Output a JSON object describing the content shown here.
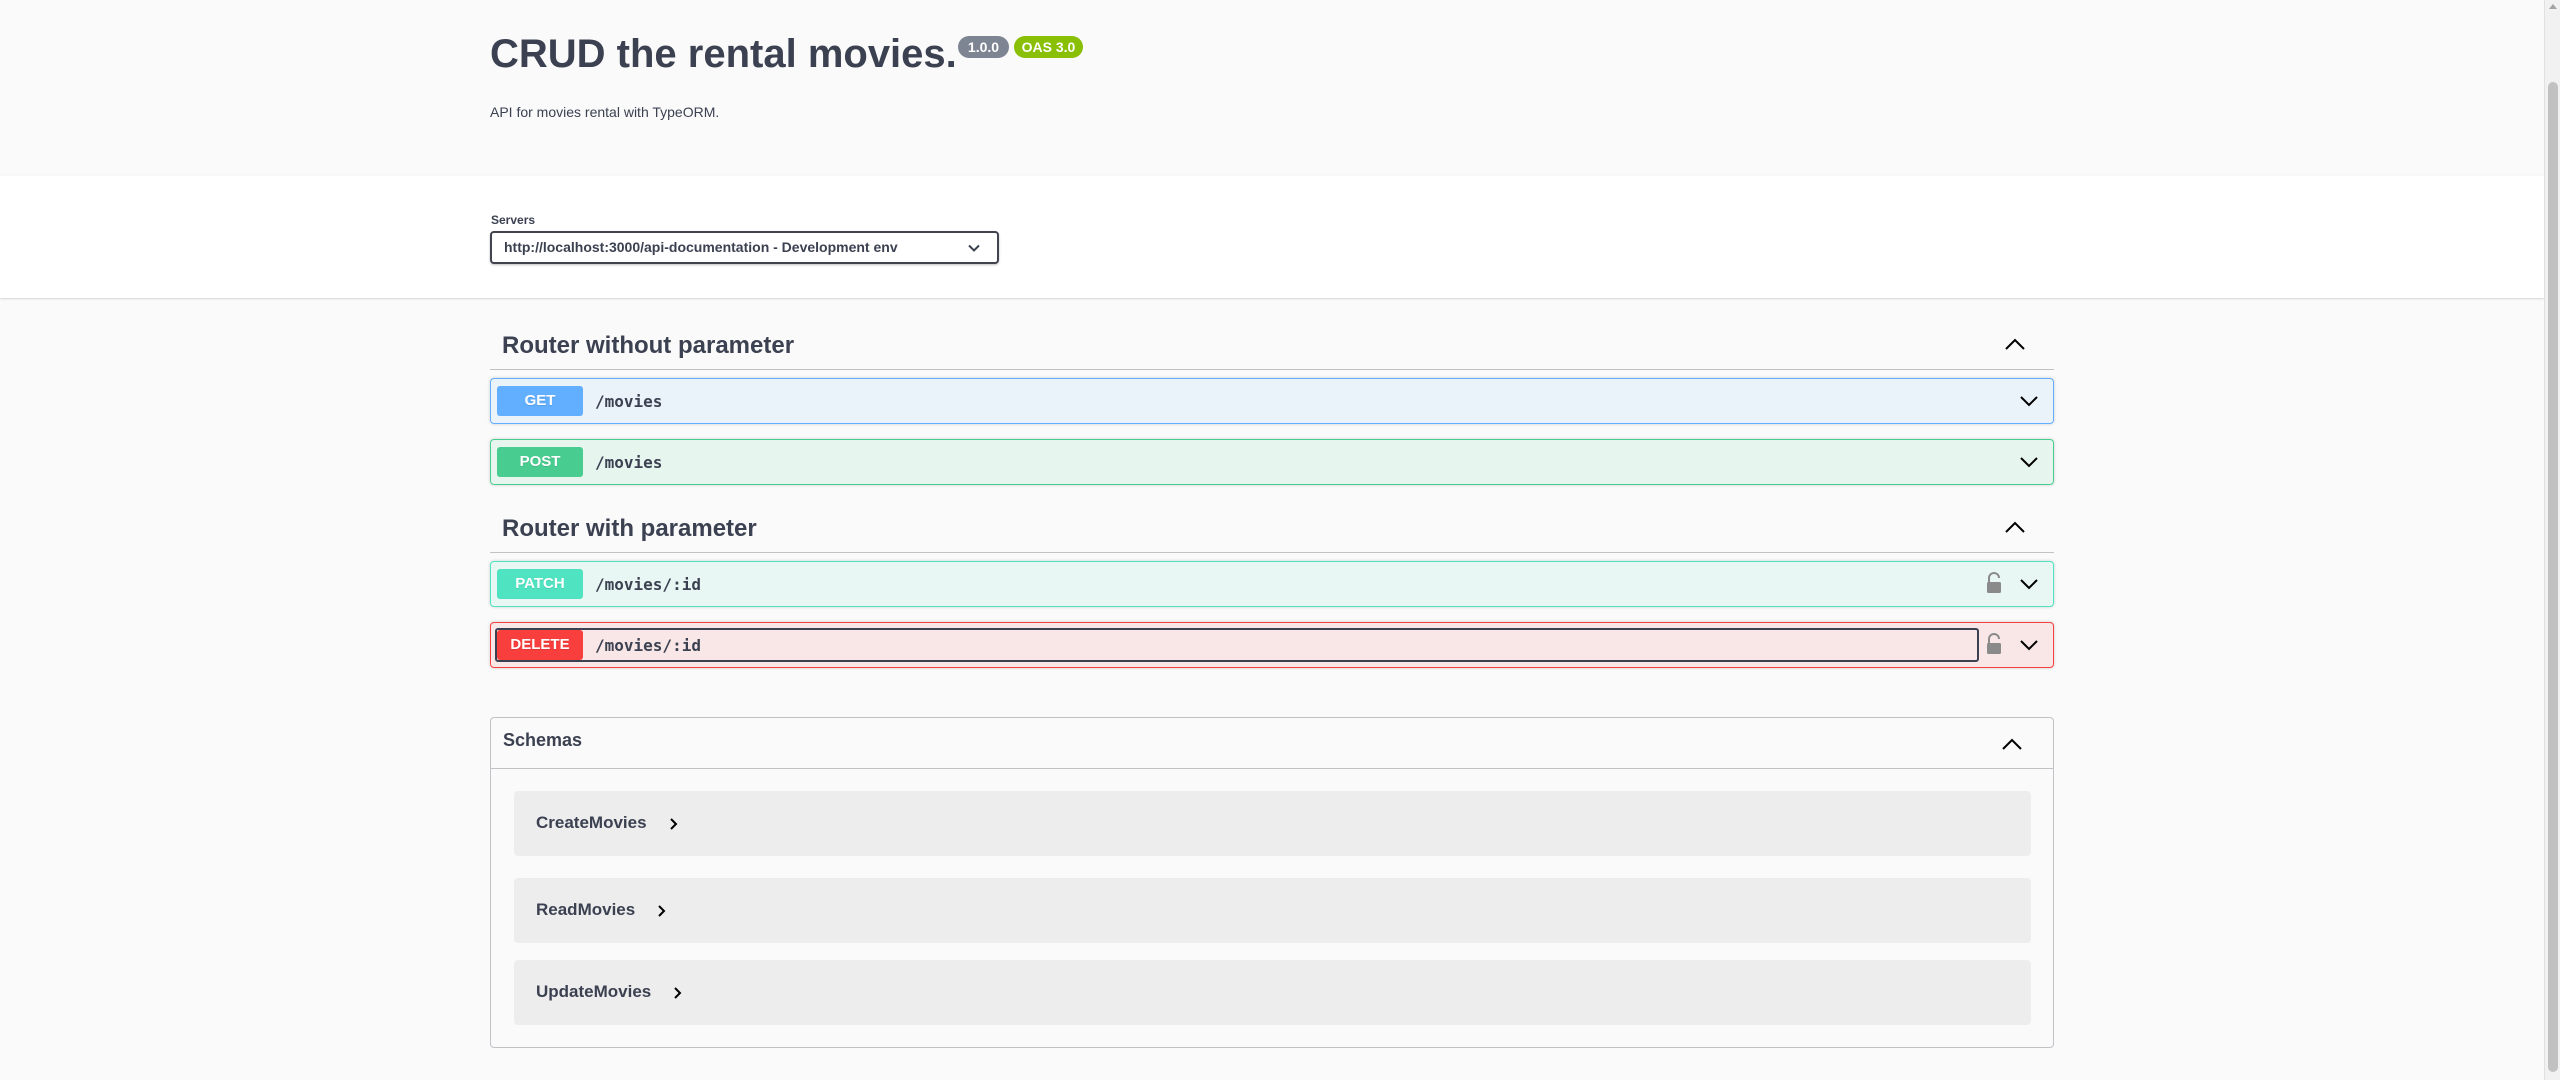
{
  "info": {
    "title": "CRUD the rental movies.",
    "version_badge": "1.0.0",
    "oas_badge": "OAS 3.0",
    "description": "API for movies rental with TypeORM."
  },
  "servers": {
    "label": "Servers",
    "selected": "http://localhost:3000/api-documentation - Development env"
  },
  "sections": [
    {
      "name": "Router without parameter",
      "operations": [
        {
          "method": "GET",
          "path": "/movies"
        },
        {
          "method": "POST",
          "path": "/movies"
        }
      ]
    },
    {
      "name": "Router with parameter",
      "operations": [
        {
          "method": "PATCH",
          "path": "/movies/:id"
        },
        {
          "method": "DELETE",
          "path": "/movies/:id"
        }
      ]
    }
  ],
  "schemas": {
    "label": "Schemas",
    "models": [
      "CreateMovies",
      "ReadMovies",
      "UpdateMovies"
    ]
  },
  "icons": {
    "section_toggle": "chevron-up-icon",
    "op_toggle": "chevron-down-icon",
    "auth": "lock-icon",
    "model_expand": "chevron-right-icon"
  },
  "colors": {
    "get": "#61affe",
    "post": "#49cc90",
    "patch": "#50e3c2",
    "delete": "#f93e3e",
    "oas_badge": "#89bf04",
    "version_badge": "#7d8492"
  }
}
